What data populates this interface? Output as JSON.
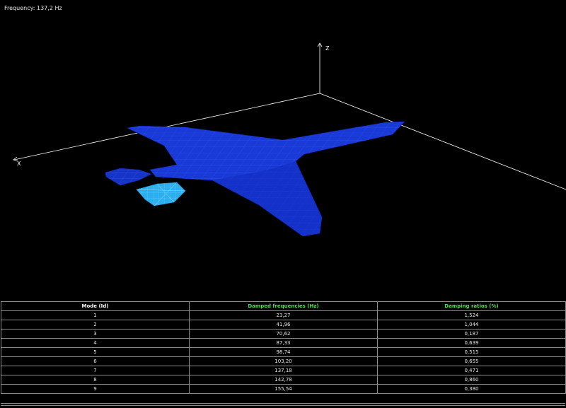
{
  "viewport": {
    "frequency_label": "Frequency:",
    "frequency_value": "137,2 Hz",
    "axes": {
      "x": "X",
      "z": "Z"
    },
    "colors": {
      "background": "#000000",
      "mesh_fill": "#1a3ad8",
      "mesh_highlight": "#2ab0f0",
      "axis": "#ffffff"
    }
  },
  "modes_table": {
    "headers": [
      "Mode (Id)",
      "Damped frequencies (Hz)",
      "Damping ratios (%)"
    ],
    "header_colors": [
      "#ffffff",
      "#55dd55",
      "#55dd55"
    ],
    "rows": [
      [
        "1",
        "23,27",
        "1,524"
      ],
      [
        "2",
        "41,96",
        "1,044"
      ],
      [
        "3",
        "70,62",
        "0,187"
      ],
      [
        "4",
        "87,33",
        "0,639"
      ],
      [
        "5",
        "98,74",
        "0,515"
      ],
      [
        "6",
        "103,20",
        "0,655"
      ],
      [
        "7",
        "137,18",
        "0,471"
      ],
      [
        "8",
        "142,78",
        "0,860"
      ],
      [
        "9",
        "155,54",
        "0,380"
      ]
    ]
  }
}
